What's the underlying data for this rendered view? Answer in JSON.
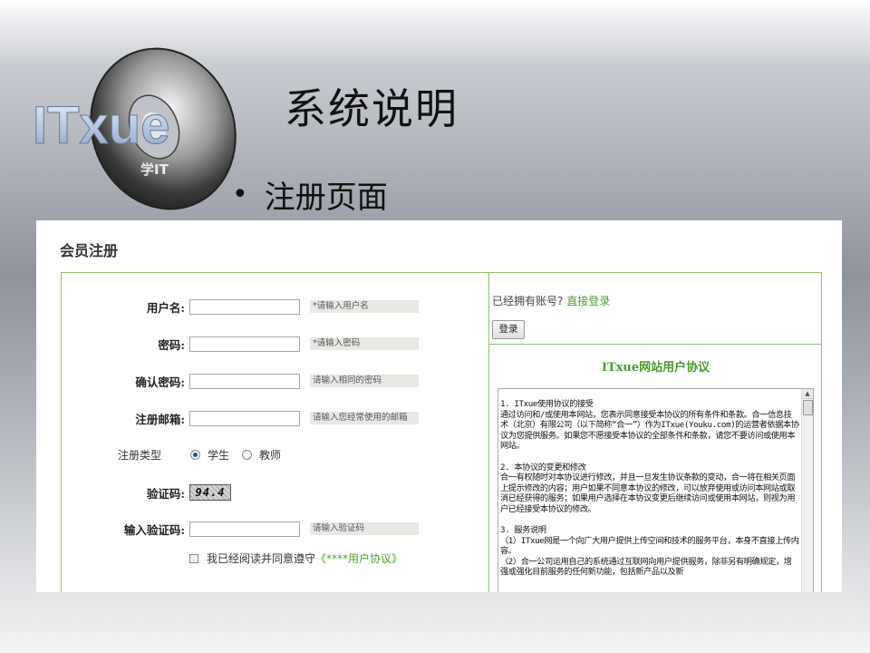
{
  "slide": {
    "logo_text": "ITxue",
    "logo_sub": "学IT",
    "title": "系统说明",
    "bullet": "注册页面"
  },
  "registration": {
    "header": "会员注册",
    "fields": [
      {
        "label": "用户名:",
        "hint": "*请输入用户名"
      },
      {
        "label": "密码:",
        "hint": "*请输入密码"
      },
      {
        "label": "确认密码:",
        "hint": "请输入相同的密码"
      },
      {
        "label": "注册邮箱:",
        "hint": "请输入您经常使用的邮箱"
      }
    ],
    "type_label": "注册类型",
    "type_options": [
      "学生",
      "教师"
    ],
    "type_selected": "学生",
    "captcha_label": "验证码:",
    "captcha_text": "94.4",
    "captcha_input_label": "输入验证码:",
    "captcha_input_hint": "请输入验证码",
    "agree_text": "我已经阅读并同意遵守",
    "agree_link": "《****用户协议》",
    "have_account": "已经拥有账号?",
    "login_link": "直接登录",
    "login_button": "登录",
    "agreement_title": "ITxue网站用户协议",
    "agreement_paragraphs": [
      "1. ITxue使用协议的接受\n通过访问和/或使用本网站，您表示同意接受本协议的所有条件和条款。合一信息技术（北京）有限公司（以下简称“合一”）作为ITxue(Youku.com)的运营者依据本协议为您提供服务。如果您不愿接受本协议的全部条件和条款，请您不要访问或使用本网站。",
      "2. 本协议的变更和修改\n 合一有权随时对本协议进行修改，并且一旦发生协议条款的变动，合一将在相关页面上提示修改的内容；用户如果不同意本协议的修改，可以放弃使用或访问本网站或取消已经获得的服务；如果用户选择在本协议变更后继续访问或使用本网站，则视为用户已经接受本协议的修改。",
      "3. 服务说明\n（1）ITxue网是一个向广大用户提供上传空间和技术的服务平台，本身不直接上传内容。\n（2）合一公司运用自己的系统通过互联网向用户提供服务，除非另有明确规定，增强或强化目前服务的任何新功能，包括新产品以及新"
    ]
  }
}
